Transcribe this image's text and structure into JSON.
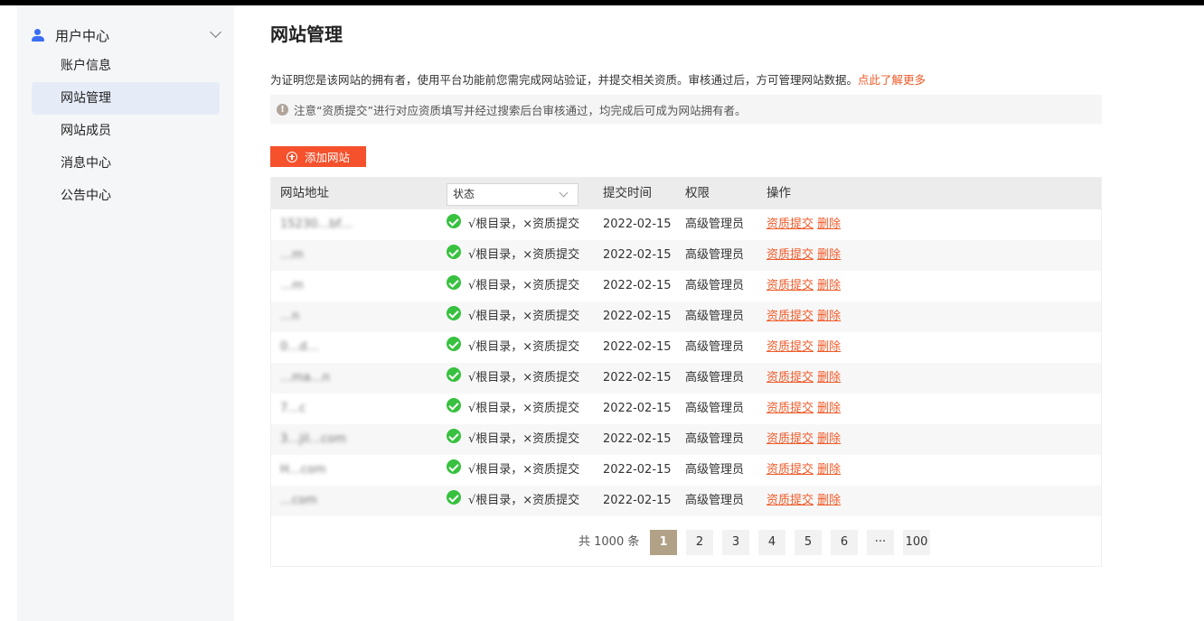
{
  "sidebar": {
    "group_title": "用户中心",
    "items": [
      {
        "label": "账户信息"
      },
      {
        "label": "网站管理"
      },
      {
        "label": "网站成员"
      },
      {
        "label": "消息中心"
      },
      {
        "label": "公告中心"
      }
    ],
    "active_index": 1
  },
  "main": {
    "title": "网站管理",
    "description": "为证明您是该网站的拥有者，使用平台功能前您需完成网站验证，并提交相关资质。审核通过后，方可管理网站数据。",
    "learn_more_link": "点此了解更多",
    "notice": "注意“资质提交”进行对应资质填写并经过搜索后台审核通过，均完成后可成为网站拥有者。",
    "add_button": "添加网站"
  },
  "table": {
    "headers": {
      "url": "网站地址",
      "time": "提交时间",
      "perm": "权限",
      "ops": "操作"
    },
    "status_select": {
      "value": "状态"
    },
    "rows": [
      {
        "url": "15230…bf…",
        "status": "√根目录，×资质提交",
        "date": "2022-02-15",
        "perm": "高级管理员",
        "op1": "资质提交",
        "op2": "删除"
      },
      {
        "url": "…m",
        "status": "√根目录，×资质提交",
        "date": "2022-02-15",
        "perm": "高级管理员",
        "op1": "资质提交",
        "op2": "删除"
      },
      {
        "url": "…m",
        "status": "√根目录，×资质提交",
        "date": "2022-02-15",
        "perm": "高级管理员",
        "op1": "资质提交",
        "op2": "删除"
      },
      {
        "url": "…n",
        "status": "√根目录，×资质提交",
        "date": "2022-02-15",
        "perm": "高级管理员",
        "op1": "资质提交",
        "op2": "删除"
      },
      {
        "url": "0…d…",
        "status": "√根目录，×资质提交",
        "date": "2022-02-15",
        "perm": "高级管理员",
        "op1": "资质提交",
        "op2": "删除"
      },
      {
        "url": "…ma…n",
        "status": "√根目录，×资质提交",
        "date": "2022-02-15",
        "perm": "高级管理员",
        "op1": "资质提交",
        "op2": "删除"
      },
      {
        "url": "7…c",
        "status": "√根目录，×资质提交",
        "date": "2022-02-15",
        "perm": "高级管理员",
        "op1": "资质提交",
        "op2": "删除"
      },
      {
        "url": "3…jil…com",
        "status": "√根目录，×资质提交",
        "date": "2022-02-15",
        "perm": "高级管理员",
        "op1": "资质提交",
        "op2": "删除"
      },
      {
        "url": "H…com",
        "status": "√根目录，×资质提交",
        "date": "2022-02-15",
        "perm": "高级管理员",
        "op1": "资质提交",
        "op2": "删除"
      },
      {
        "url": "…com",
        "status": "√根目录，×资质提交",
        "date": "2022-02-15",
        "perm": "高级管理员",
        "op1": "资质提交",
        "op2": "删除"
      }
    ]
  },
  "pagination": {
    "total_text": "共 1000 条",
    "pages": [
      "1",
      "2",
      "3",
      "4",
      "5",
      "6",
      "···",
      "100"
    ],
    "current": "1"
  }
}
